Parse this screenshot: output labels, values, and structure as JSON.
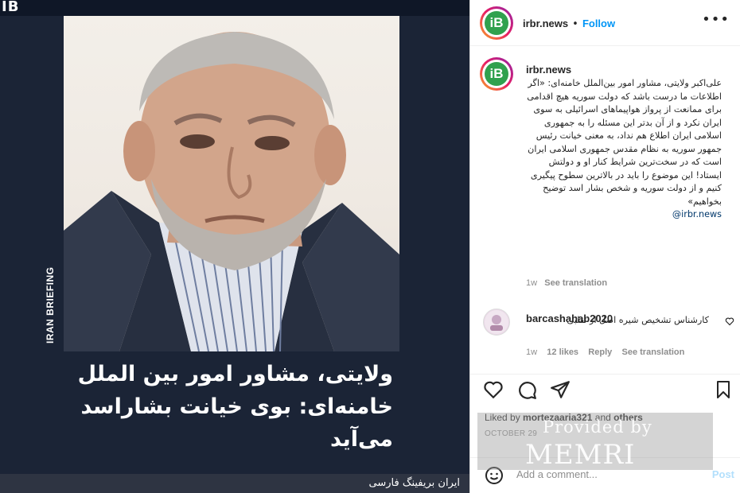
{
  "media": {
    "brand": "IB",
    "vertical_label": "IRAN BRIEFING",
    "headline": "ولایتی، مشاور امور بین الملل خامنه‌ای: بوی خیانت بشاراسد می‌آید",
    "footer": "ایران بریفینگ فارسی"
  },
  "post": {
    "avatar_text": "iB",
    "username": "irbr.news",
    "separator": "•",
    "follow_label": "Follow",
    "more_label": "•••",
    "caption_user": "irbr.news",
    "caption": "علی‌اکبر ولایتی، مشاور امور بین‌الملل خامنه‌ای: «اگر اطلاعات ما درست باشد که دولت سوریه هیچ اقدامی برای ممانعت از پرواز هواپیماهای اسرائیلی به سوی ایران نکرد و از آن بدتر این مسئله را به جمهوری اسلامی ایران اطلاع هم نداد، به معنی خیانت رئیس جمهور سوریه به نظام مقدس جمهوری اسلامی ایران است که در سخت‌ترین شرایط کنار او و دولتش ایستاد! این موضوع را باید در بالاترین سطوح پیگیری کنیم و از دولت سوریه و شخص بشار اسد توضیح بخواهیم»",
    "caption_tag": "irbr.news@",
    "caption_time": "1w",
    "see_translation": "See translation",
    "comment": {
      "user": "barcashahab2020",
      "text": "کارشناس تشخیص شیره اصل از تقلبی",
      "time": "1w",
      "likes": "12 likes",
      "reply": "Reply",
      "see_translation": "See translation"
    },
    "liked_by_prefix": "Liked by",
    "liked_by_user": "mortezaaria321",
    "liked_by_suffix": "and",
    "liked_by_others": "others",
    "date": "October 29",
    "add_comment_placeholder": "Add a comment...",
    "post_label": "Post"
  },
  "watermark": {
    "line1": "Provided by",
    "line2": "MEMRI"
  },
  "colors": {
    "media_bg": "#1b2436",
    "accent_blue": "#0095f6",
    "avatar_green": "#30a14e"
  },
  "icons": [
    "heart-icon",
    "comment-icon",
    "share-icon",
    "bookmark-icon",
    "emoji-icon",
    "more-icon",
    "comment-like-icon"
  ]
}
